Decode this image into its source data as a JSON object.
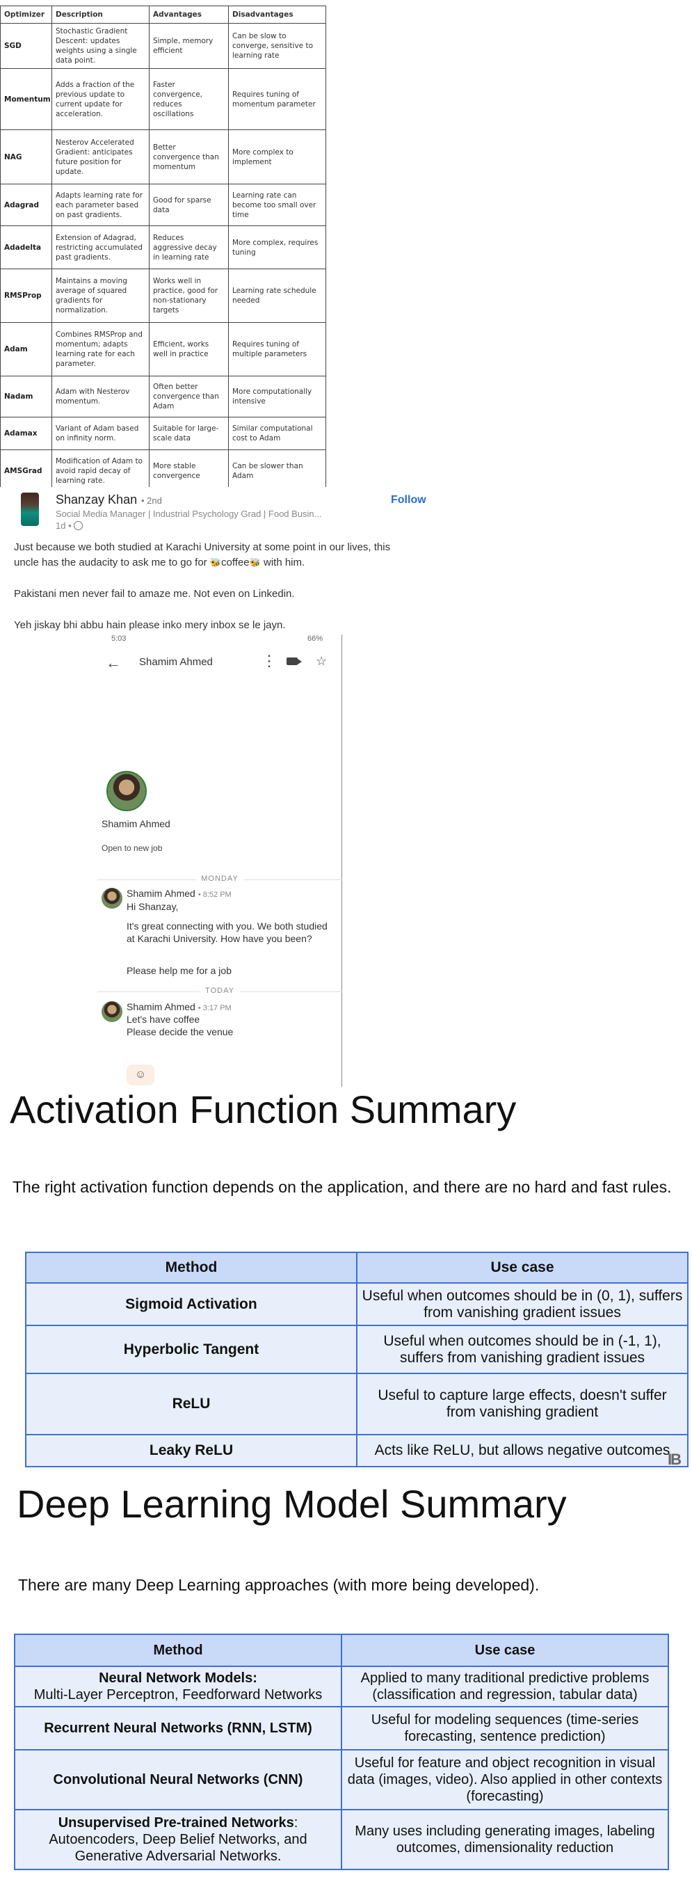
{
  "optimizer_table": {
    "headers": [
      "Optimizer",
      "Description",
      "Advantages",
      "Disadvantages"
    ],
    "rows": [
      {
        "name": "SGD",
        "description": "Stochastic Gradient Descent: updates weights using a single data point.",
        "advantages": "Simple, memory efficient",
        "disadvantages": "Can be slow to converge, sensitive to learning rate"
      },
      {
        "name": "Momentum",
        "description": "Adds a fraction of the previous update to current update for acceleration.",
        "advantages": "Faster convergence, reduces oscillations",
        "disadvantages": "Requires tuning of momentum parameter"
      },
      {
        "name": "NAG",
        "description": "Nesterov Accelerated Gradient: anticipates future position for update.",
        "advantages": "Better convergence than momentum",
        "disadvantages": "More complex to implement"
      },
      {
        "name": "Adagrad",
        "description": "Adapts learning rate for each parameter based on past gradients.",
        "advantages": "Good for sparse data",
        "disadvantages": "Learning rate can become too small over time"
      },
      {
        "name": "Adadelta",
        "description": "Extension of Adagrad, restricting accumulated past gradients.",
        "advantages": "Reduces aggressive decay in learning rate",
        "disadvantages": "More complex, requires tuning"
      },
      {
        "name": "RMSProp",
        "description": "Maintains a moving average of squared gradients for normalization.",
        "advantages": "Works well in practice, good for non-stationary targets",
        "disadvantages": "Learning rate schedule needed"
      },
      {
        "name": "Adam",
        "description": "Combines RMSProp and momentum; adapts learning rate for each parameter.",
        "advantages": "Efficient, works well in practice",
        "disadvantages": "Requires tuning of multiple parameters"
      },
      {
        "name": "Nadam",
        "description": "Adam with Nesterov momentum.",
        "advantages": "Often better convergence than Adam",
        "disadvantages": "More computationally intensive"
      },
      {
        "name": "Adamax",
        "description": "Variant of Adam based on infinity norm.",
        "advantages": "Suitable for large-scale data",
        "disadvantages": "Similar computational cost to Adam"
      },
      {
        "name": "AMSGrad",
        "description": "Modification of Adam to avoid rapid decay of learning rate.",
        "advantages": "More stable convergence",
        "disadvantages": "Can be slower than Adam"
      }
    ]
  },
  "post": {
    "author": "Shanzay Khan",
    "degree": "• 2nd",
    "headline": "Social Media Manager | Industrial Psychology Grad | Food Busin...",
    "time": "1d •",
    "follow_label": "Follow",
    "text_line1a": "Just because we both studied at Karachi University at some point in our lives, this",
    "text_line1b_pre": "uncle has the audacity to ask me to go for",
    "text_line1b_mid": "coffee",
    "text_line1b_post": "with him.",
    "text_line2": "Pakistani men never fail to amaze me. Not even on Linkedin.",
    "text_line3": "Yeh jiskay bhi abbu hain please inko mery inbox se le jayn."
  },
  "phone": {
    "status_time": "5:03",
    "status_right": "66%",
    "title": "Shamim Ahmed",
    "profile_name": "Shamim Ahmed",
    "profile_status": "Open to new job",
    "day1": "MONDAY",
    "msg1_sender": "Shamim Ahmed",
    "msg1_time": "• 8:52 PM",
    "msg1_line1": "Hi Shanzay,",
    "msg1_line2": "It's great connecting with you. We both studied at Karachi University. How have you been?",
    "msg1_line3": "Please help me for a job",
    "day2": "TODAY",
    "msg2_sender": "Shamim Ahmed",
    "msg2_time": "• 3:17 PM",
    "msg2_line1": "Let's have coffee",
    "msg2_line2": "Please decide the venue"
  },
  "activation": {
    "title": "Activation Function Summary",
    "subtitle": "The right activation function depends on the application, and there are no hard and fast rules.",
    "headers": [
      "Method",
      "Use case"
    ],
    "rows": [
      {
        "method": "Sigmoid Activation",
        "use": "Useful when outcomes should be in (0, 1), suffers from vanishing gradient issues"
      },
      {
        "method": "Hyperbolic Tangent",
        "use": "Useful when outcomes should be in (-1, 1), suffers from vanishing gradient issues"
      },
      {
        "method": "ReLU",
        "use": "Useful to capture large effects, doesn't suffer from vanishing gradient"
      },
      {
        "method": "Leaky ReLU",
        "use": "Acts like ReLU, but allows negative outcomes"
      }
    ],
    "logo_text": "IB"
  },
  "deep_learning": {
    "title": "Deep Learning Model Summary",
    "subtitle": "There are many Deep Learning approaches (with more being developed).",
    "headers": [
      "Method",
      "Use case"
    ],
    "rows": [
      {
        "method_bold": "Neural Network Models:",
        "method_rest": "Multi-Layer Perceptron, Feedforward Networks",
        "use": "Applied to many traditional predictive problems (classification and regression, tabular data)"
      },
      {
        "method_bold": "Recurrent Neural Networks (RNN, LSTM)",
        "method_rest": "",
        "use": "Useful for modeling sequences (time-series forecasting, sentence prediction)"
      },
      {
        "method_bold": "Convolutional Neural Networks (CNN)",
        "method_rest": "",
        "use": "Useful for feature and object recognition in visual data (images, video). Also applied in other contexts (forecasting)"
      },
      {
        "method_bold": "Unsupervised Pre-trained Networks",
        "method_rest": ": Autoencoders, Deep Belief Networks, and Generative Adversarial Networks.",
        "use": "Many uses including generating images, labeling outcomes, dimensionality reduction"
      }
    ]
  }
}
